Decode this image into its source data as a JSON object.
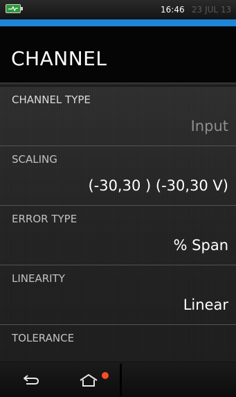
{
  "status": {
    "time": "16:46",
    "date": "23 JUL 13"
  },
  "colors": {
    "accent": "#1e86d8",
    "battery": "#2f9a3a",
    "notification": "#ff4a2a"
  },
  "page": {
    "title": "CHANNEL"
  },
  "items": [
    {
      "label": "CHANNEL TYPE",
      "value": "Input"
    },
    {
      "label": "SCALING",
      "value": "(-30,30 ) (-30,30 V)"
    },
    {
      "label": "ERROR TYPE",
      "value": "% Span"
    },
    {
      "label": "LINEARITY",
      "value": "Linear"
    },
    {
      "label": "TOLERANCE",
      "value": ""
    }
  ],
  "icons": {
    "battery": "battery-charging-icon",
    "back": "back-arrow-icon",
    "home": "home-icon"
  }
}
